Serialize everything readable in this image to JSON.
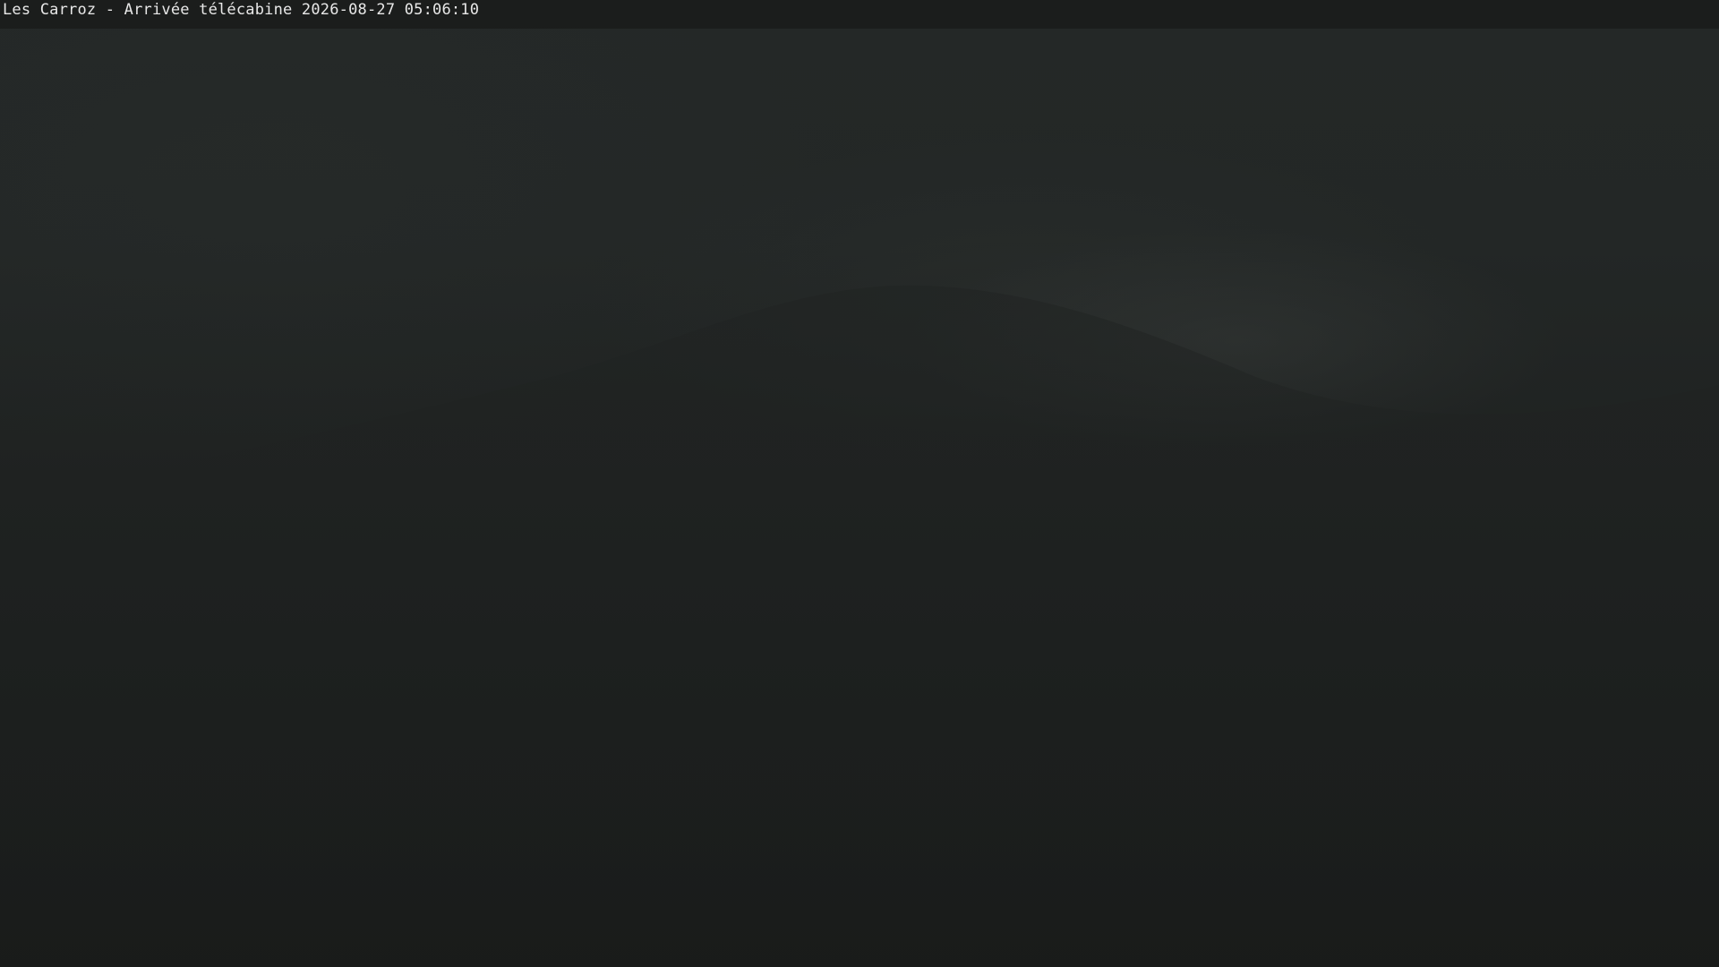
{
  "overlay": {
    "caption": "Les Carroz - Arrivée télécabine 2026-08-27 05:06:10"
  },
  "scene": {
    "description_colors": {
      "sky_top": "#242827",
      "ground_bottom": "#1a1c1b",
      "bar_background": "#1b1d1c",
      "caption_text": "#e8e8e8"
    }
  }
}
